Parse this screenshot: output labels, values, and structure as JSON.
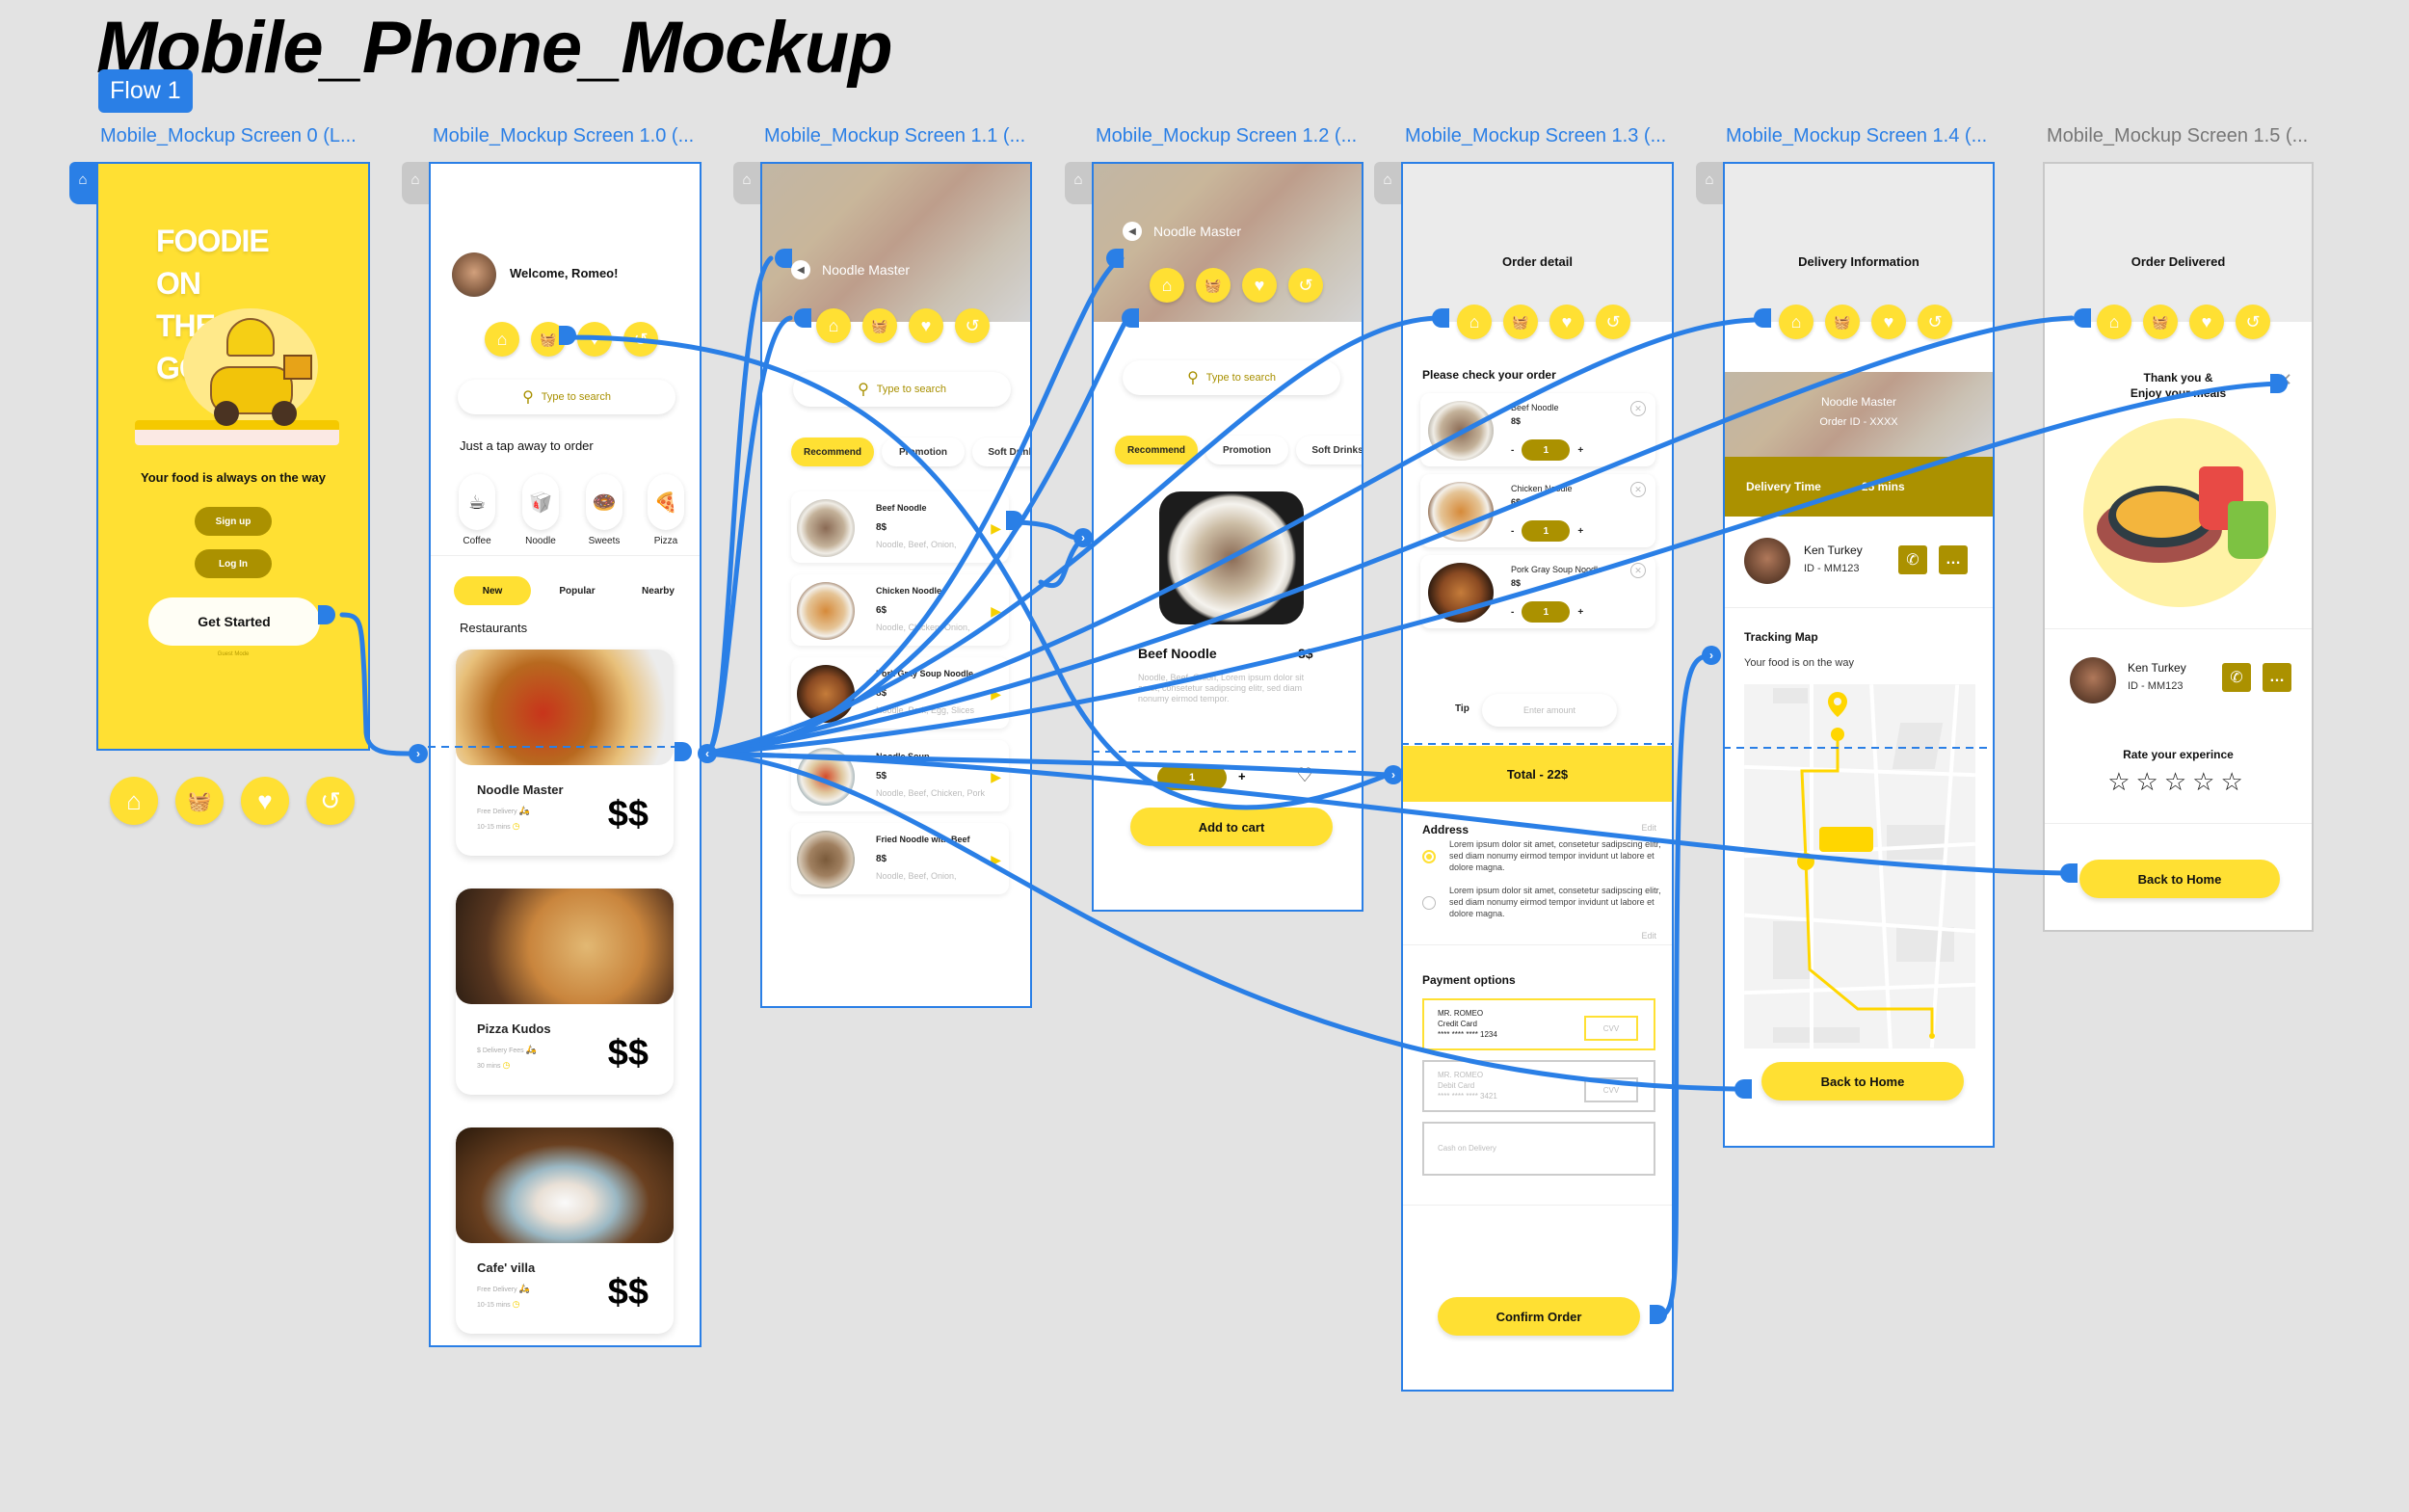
{
  "document": {
    "title": "Mobile_Phone_Mockup",
    "flow_badge": "Flow 1"
  },
  "frames": [
    {
      "label": "Mobile_Mockup Screen 0 (L..."
    },
    {
      "label": "Mobile_Mockup Screen 1.0 (..."
    },
    {
      "label": "Mobile_Mockup Screen 1.1 (..."
    },
    {
      "label": "Mobile_Mockup Screen 1.2 (..."
    },
    {
      "label": "Mobile_Mockup Screen 1.3 (..."
    },
    {
      "label": "Mobile_Mockup Screen 1.4 (..."
    },
    {
      "label": "Mobile_Mockup Screen 1.5 (..."
    }
  ],
  "icons": {
    "home": "⌂",
    "basket": "🧺",
    "heart": "♥",
    "history": "↺",
    "search": "⚲",
    "back": "◀",
    "close": "✕",
    "phone": "✆",
    "chat": "…",
    "star": "☆",
    "arrow_right": "▶",
    "bike": "🛵",
    "clock": "◷",
    "chevron_left": "‹",
    "chevron_right": "›"
  },
  "screen0": {
    "headline": [
      "FOODIE",
      "ON",
      "THE",
      "GO"
    ],
    "tagline": "Your food is always on the way",
    "signup": "Sign up",
    "login": "Log In",
    "get_started": "Get Started",
    "guest_mode": "Guest Mode"
  },
  "screen1_0": {
    "welcome": "Welcome, Romeo!",
    "search_placeholder": "Type to search",
    "section_title": "Just a tap away to order",
    "categories": [
      {
        "label": "Coffee",
        "icon": "☕"
      },
      {
        "label": "Noodle",
        "icon": "🥡"
      },
      {
        "label": "Sweets",
        "icon": "🍩"
      },
      {
        "label": "Pizza",
        "icon": "🍕"
      }
    ],
    "tabs": [
      "New",
      "Popular",
      "Nearby"
    ],
    "restaurants_title": "Restaurants",
    "restaurants": [
      {
        "name": "Noodle Master",
        "delivery": "Free Delivery",
        "time": "10-15 mins",
        "price": "$$"
      },
      {
        "name": "Pizza Kudos",
        "delivery": "$ Delivery Fees",
        "time": "30 mins",
        "price": "$$"
      },
      {
        "name": "Cafe' villa",
        "delivery": "Free Delivery",
        "time": "10-15 mins",
        "price": "$$"
      }
    ]
  },
  "screen1_1": {
    "header": "Noodle Master",
    "search_placeholder": "Type to search",
    "tabs": [
      "Recommend",
      "Promotion",
      "Soft Drinks"
    ],
    "items": [
      {
        "name": "Beef Noodle",
        "price": "8$",
        "ingredients": "Noodle, Beef, Onion,"
      },
      {
        "name": "Chicken Noodle",
        "price": "6$",
        "ingredients": "Noodle, Chicken, Onion,"
      },
      {
        "name": "Pork Gray Soup Noodle",
        "price": "8$",
        "ingredients": "Noodle, Pork, Egg, Slices"
      },
      {
        "name": "Noodle Soup",
        "price": "5$",
        "ingredients": "Noodle, Beef, Chicken, Pork"
      },
      {
        "name": "Fried Noodle with Beef",
        "price": "8$",
        "ingredients": "Noodle, Beef, Onion,"
      }
    ]
  },
  "screen1_2": {
    "header": "Noodle Master",
    "search_placeholder": "Type to search",
    "tabs": [
      "Recommend",
      "Promotion",
      "Soft Drinks"
    ],
    "product_name": "Beef Noodle",
    "product_price": "8$",
    "description": "Noodle, Beef, Onion, Lorem ipsum dolor sit amet, consetetur sadipscing elitr, sed diam nonumy eirmod tempor.",
    "quantity": "1",
    "plus": "+",
    "add_to_cart": "Add to cart"
  },
  "screen1_3": {
    "title": "Order detail",
    "subtitle": "Please check your order",
    "items": [
      {
        "name": "Beef Noodle",
        "price": "8$",
        "qty": "1"
      },
      {
        "name": "Chicken Noodle",
        "price": "6$",
        "qty": "1"
      },
      {
        "name": "Pork Gray Soup Noodle",
        "price": "8$",
        "qty": "1"
      }
    ],
    "minus": "-",
    "plus": "+",
    "tip_label": "Tip",
    "tip_placeholder": "Enter amount",
    "total": "Total -  22$",
    "address_title": "Address",
    "edit": "Edit",
    "addresses": [
      {
        "text": "Lorem ipsum dolor sit amet, consetetur sadipscing elitr, sed diam nonumy eirmod tempor invidunt ut labore et dolore magna.",
        "selected": true
      },
      {
        "text": "Lorem ipsum dolor sit amet, consetetur sadipscing elitr, sed diam nonumy eirmod tempor invidunt ut labore et dolore magna.",
        "selected": false
      }
    ],
    "payment_title": "Payment options",
    "payments": [
      {
        "line1": "MR. ROMEO",
        "line2": "Credit Card",
        "line3": "**** **** **** 1234",
        "cvv": "CVV",
        "selected": true
      },
      {
        "line1": "MR. ROMEO",
        "line2": "Debit Card",
        "line3": "**** **** **** 3421",
        "cvv": "CVV",
        "selected": false
      },
      {
        "line1": "Cash on Delivery",
        "line2": "",
        "line3": "",
        "cvv": "",
        "selected": false
      }
    ],
    "confirm": "Confirm Order"
  },
  "screen1_4": {
    "title": "Delivery Information",
    "restaurant": "Noodle Master",
    "order_id": "Order ID - XXXX",
    "delivery_time_label": "Delivery Time",
    "delivery_time_value": "25 mins",
    "driver_name": "Ken Turkey",
    "driver_id": "ID - MM123",
    "tracking_title": "Tracking Map",
    "tracking_sub": "Your food is on the way",
    "back_home": "Back to Home"
  },
  "screen1_5": {
    "title": "Order Delivered",
    "thanks_line1": "Thank you &",
    "thanks_line2": "Enjoy your meals",
    "driver_name": "Ken Turkey",
    "driver_id": "ID - MM123",
    "rate_title": "Rate your experince",
    "rating": 0,
    "rating_max": 5,
    "back_home": "Back to Home"
  },
  "colors": {
    "brand_yellow": "#ffe033",
    "olive": "#ab9100",
    "prototype_blue": "#2a7fe6",
    "canvas_gray": "#e3e3e3"
  }
}
